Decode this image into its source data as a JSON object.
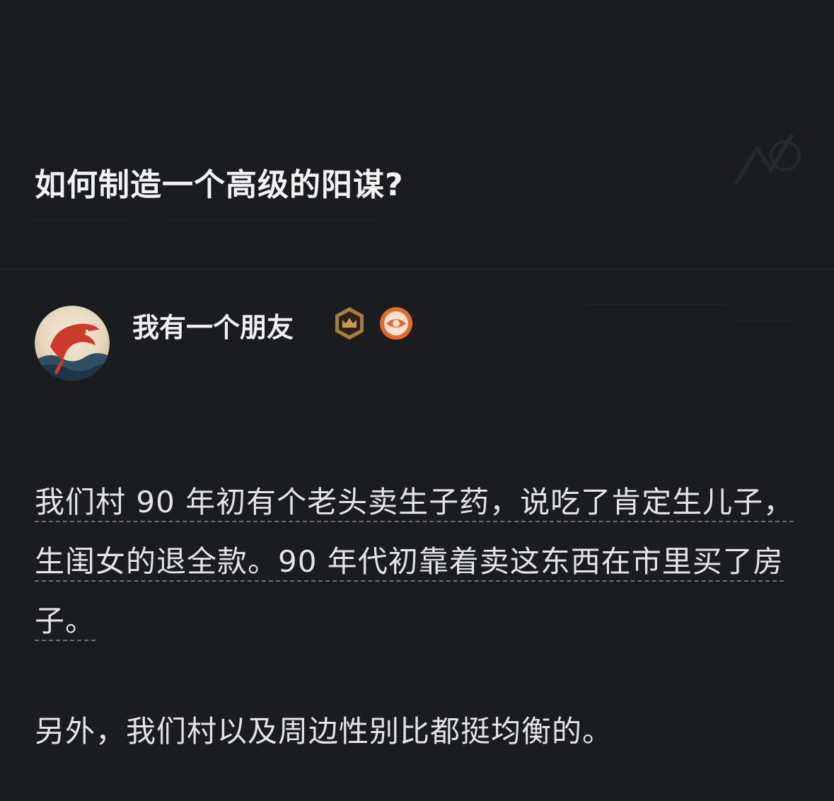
{
  "question": {
    "title": "如何制造一个高级的阳谋?"
  },
  "answer": {
    "author": {
      "name": "我有一个朋友",
      "avatar_icon": "dolphin-avatar-icon",
      "badges": [
        {
          "icon": "crown-badge-icon",
          "color": "#8a6a3c"
        },
        {
          "icon": "eye-badge-icon",
          "color": "#e0682a"
        }
      ]
    },
    "paragraphs": [
      "我们村 90 年初有个老头卖生子药，说吃了肯定生儿子，生闺女的退全款。90 年代初靠着卖这东西在市里买了房子。",
      "另外，我们村以及周边性别比都挺均衡的。"
    ]
  },
  "colors": {
    "background": "#1b1c20",
    "text": "#e4e4e4",
    "underline": "#6d6e74"
  }
}
